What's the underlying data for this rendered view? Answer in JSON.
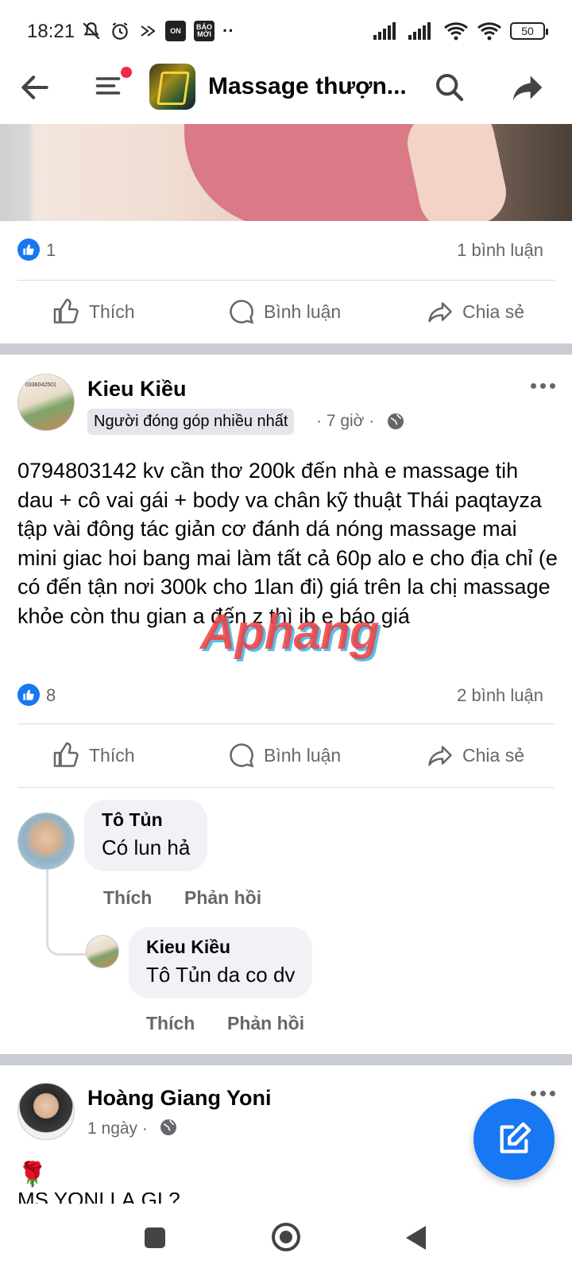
{
  "status_bar": {
    "time": "18:21",
    "badge_on": "ON",
    "badge_bao": "BÁO MỚI",
    "more": "··",
    "battery": "50"
  },
  "app_bar": {
    "title": "Massage thượn...",
    "back_icon": "arrow-left-icon",
    "menu_icon": "hamburger-menu-icon",
    "search_icon": "search-icon",
    "share_icon": "share-arrow-icon"
  },
  "post1": {
    "likes": "1",
    "comments": "1 bình luận",
    "actions": {
      "like": "Thích",
      "comment": "Bình luận",
      "share": "Chia sẻ"
    }
  },
  "post2": {
    "author": "Kieu Kiều",
    "badge": "Người đóng góp nhiều nhất",
    "time": "· 7 giờ ·",
    "avatar_text": "0336042501",
    "body": "0794803142 kv cần thơ 200k đến nhà e massage tih dau + cô vai gái + body va chân kỹ thuật Thái paqtayza tập vài đông tác giản cơ đánh dá nóng massage mai mini giac hoi bang mai làm tất cả 60p alo e cho địa chỉ (e có đến tận nơi 300k cho 1lan đi) giá trên la chị massage khỏe còn thu gian a đến z thì ib e báo giá",
    "watermark": "Aphang",
    "likes": "8",
    "comments": "2 bình luận",
    "actions": {
      "like": "Thích",
      "comment": "Bình luận",
      "share": "Chia sẻ"
    },
    "comment_list": [
      {
        "author": "Tô Tủn",
        "text": "Có lun hả",
        "like": "Thích",
        "reply": "Phản hồi"
      },
      {
        "author": "Kieu Kiều",
        "text": "Tô Tủn da co dv",
        "like": "Thích",
        "reply": "Phản hồi"
      }
    ]
  },
  "post3": {
    "author": "Hoàng Giang Yoni",
    "time": "1 ngày ·",
    "emoji": "🌹",
    "text_partial": "MS YONI LÀ GÌ ?"
  },
  "colors": {
    "facebook_blue": "#1877f2",
    "notification_red": "#f02849",
    "secondary_text": "#65676b",
    "section_gap": "#c9ccd1"
  }
}
